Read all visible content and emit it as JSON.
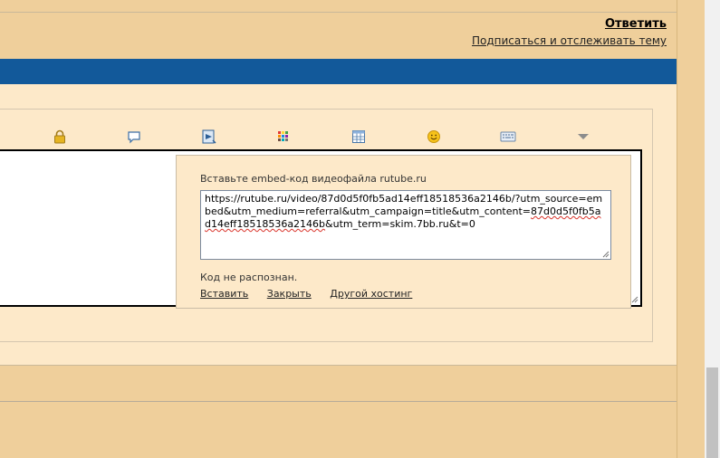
{
  "header": {
    "reply_label": "Ответить",
    "subscribe_label": "Подписаться и отслеживать тему"
  },
  "toolbar": {
    "icons": [
      "lock-icon",
      "speech-bubble-icon",
      "media-icon",
      "color-palette-icon",
      "table-icon",
      "smiley-icon",
      "keyboard-icon",
      "more-dropdown-icon"
    ]
  },
  "embed_popup": {
    "title": "Вставьте embed-код видеофайла rutube.ru",
    "value_part1": "https://rutube.ru/video/87d0d5f0fb5ad14eff18518536a2146b/?utm_source=embed&utm_medium=referral&utm_campaign=title&utm_content=",
    "value_part2": "87d0d5f0fb5ad14eff18518536a2146b",
    "value_part3": "&utm_term=skim.7bb.ru&t=0",
    "status": "Код не распознан.",
    "insert_label": "Вставить",
    "close_label": "Закрыть",
    "other_hosting_label": "Другой хостинг"
  },
  "colors": {
    "page_bg": "#efcf9b",
    "nav_bar": "#12599a",
    "panel_bg": "#fde9c9"
  }
}
